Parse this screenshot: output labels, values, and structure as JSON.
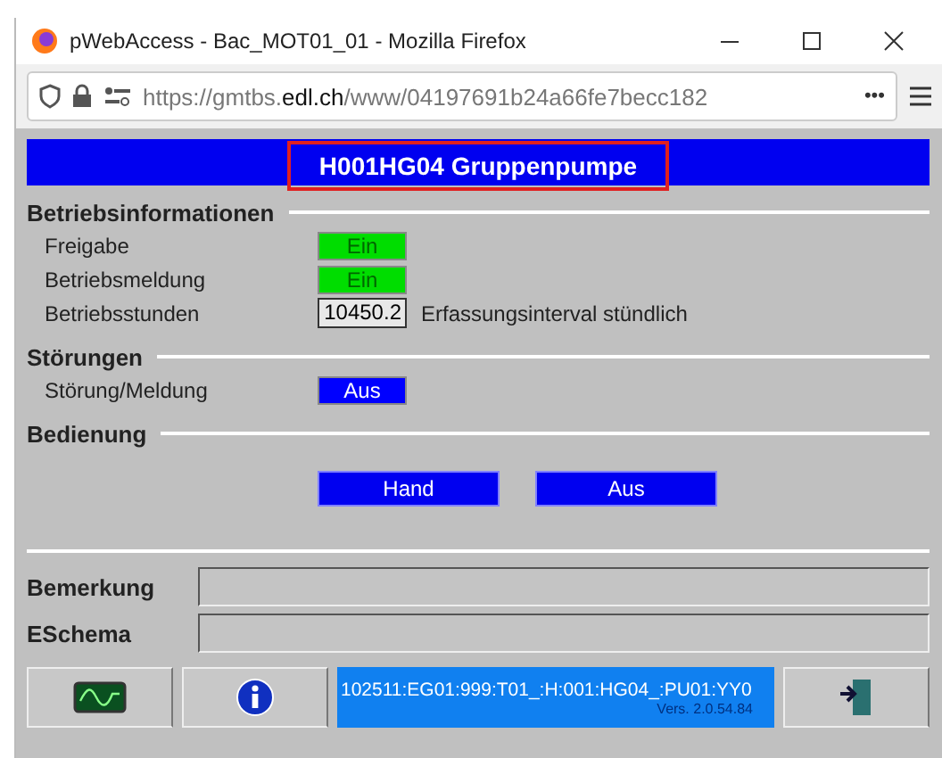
{
  "window": {
    "title": "pWebAccess - Bac_MOT01_01 - Mozilla Firefox"
  },
  "address_bar": {
    "url_prefix": "https://gmtbs.",
    "url_domain": "edl.ch",
    "url_rest": "/www/04197691b24a66fe7becc182",
    "more": "•••"
  },
  "header": {
    "title": "H001HG04 Gruppenpumpe"
  },
  "sections": [
    {
      "title": "Betriebsinformationen",
      "rows": [
        {
          "label": "Freigabe",
          "kind": "status",
          "value": "Ein",
          "color": "#00dd00"
        },
        {
          "label": "Betriebsmeldung",
          "kind": "status",
          "value": "Ein",
          "color": "#00dd00"
        },
        {
          "label": "Betriebsstunden",
          "kind": "number",
          "value": "10450.2",
          "note": "Erfassungsinterval stündlich"
        }
      ]
    },
    {
      "title": "Störungen",
      "rows": [
        {
          "label": "Störung/Meldung",
          "kind": "status",
          "value": "Aus",
          "color": "#0000ff"
        }
      ]
    },
    {
      "title": "Bedienung",
      "buttons": [
        "Hand",
        "Aus"
      ]
    }
  ],
  "fields": [
    {
      "label": "Bemerkung"
    },
    {
      "label": "ESchema"
    }
  ],
  "toolbar": {
    "path": "102511:EG01:999:T01_:H:001:HG04_:PU01:YY0",
    "version": "Vers. 2.0.54.84"
  }
}
